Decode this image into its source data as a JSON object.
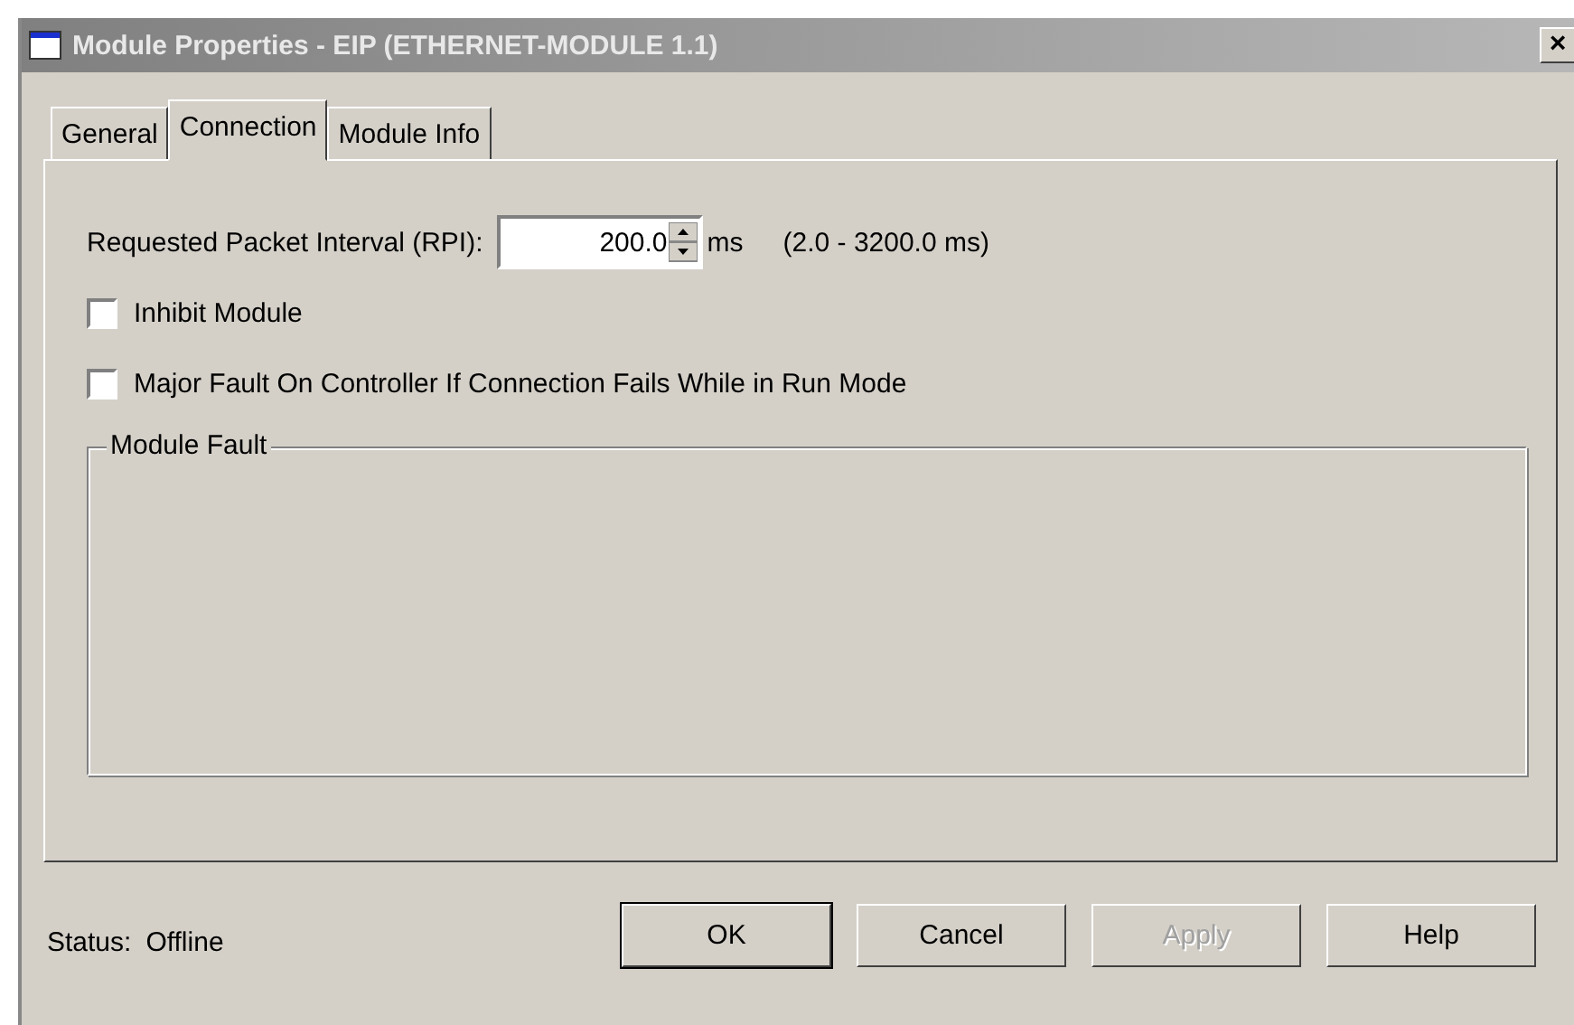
{
  "window": {
    "title": "Module Properties - EIP (ETHERNET-MODULE 1.1)",
    "close_glyph": "×"
  },
  "tabs": [
    {
      "label": "General",
      "selected": false
    },
    {
      "label": "Connection",
      "selected": true
    },
    {
      "label": "Module Info",
      "selected": false
    }
  ],
  "rpi": {
    "label": "Requested Packet Interval (RPI):",
    "value": "200.0",
    "unit": "ms",
    "range": "(2.0 - 3200.0 ms)"
  },
  "options": [
    {
      "label": "Inhibit Module",
      "checked": false
    },
    {
      "label": "Major Fault On Controller If Connection Fails While in Run Mode",
      "checked": false
    }
  ],
  "module_fault": {
    "title": "Module Fault"
  },
  "status": {
    "label": "Status:",
    "value": "Offline"
  },
  "buttons": [
    {
      "label": "OK",
      "default": true,
      "disabled": false
    },
    {
      "label": "Cancel",
      "default": false,
      "disabled": false
    },
    {
      "label": "Apply",
      "default": false,
      "disabled": true
    },
    {
      "label": "Help",
      "default": false,
      "disabled": false
    }
  ]
}
